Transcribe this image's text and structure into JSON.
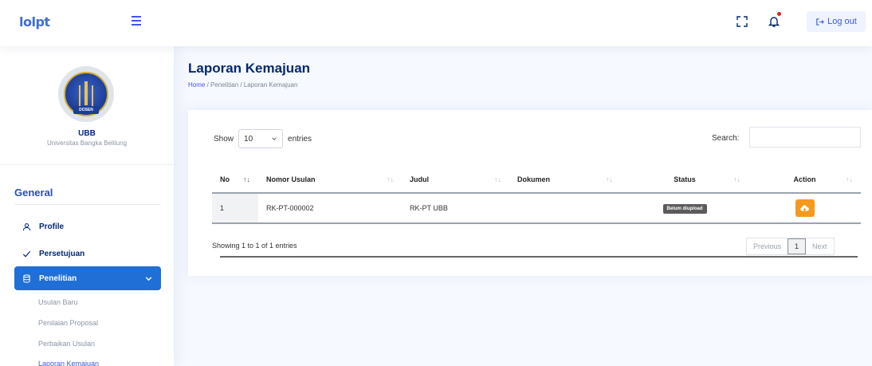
{
  "header": {
    "logo_text": "lolpt",
    "logout_label": "Log out",
    "icons": [
      "menu-icon",
      "fullscreen-icon",
      "bell-icon",
      "logout-icon"
    ]
  },
  "profile": {
    "badge": "DOSEN",
    "name": "UBB",
    "institution": "Universitas Bangka Belitung"
  },
  "sidebar": {
    "heading": "General",
    "items": [
      {
        "label": "Profile",
        "icon": "person-icon"
      },
      {
        "label": "Persetujuan",
        "icon": "check-icon"
      },
      {
        "label": "Penelitian",
        "icon": "database-icon",
        "active": true
      }
    ],
    "subitems": [
      "Usulan Baru",
      "Penilaian Proposal",
      "Perbaikan Usulan",
      "Laporan Kemajuan"
    ]
  },
  "page": {
    "title": "Laporan Kemajuan",
    "breadcrumb": {
      "home": "Home",
      "rest": " / Penelitian / Laporan Kemajuan"
    }
  },
  "table_controls": {
    "show_label": "Show",
    "entries_value": "10",
    "entries_label": "entries",
    "search_label": "Search:",
    "search_value": ""
  },
  "table": {
    "columns": [
      "No",
      "Nomor Usulan",
      "Judul",
      "Dokumen",
      "Status",
      "Action"
    ],
    "rows": [
      {
        "no": "1",
        "nomor_usulan": "RK-PT-000002",
        "judul": "RK-PT UBB",
        "dokumen": "",
        "status": "Belum diupload"
      }
    ]
  },
  "footer": {
    "info": "Showing 1 to 1 of 1 entries",
    "previous": "Previous",
    "current_page": "1",
    "next": "Next"
  },
  "colors": {
    "accent": "#4154f1",
    "active_nav": "#1f6fd6",
    "upload_button": "#f59a1c",
    "status_badge": "#5b5b5b"
  }
}
